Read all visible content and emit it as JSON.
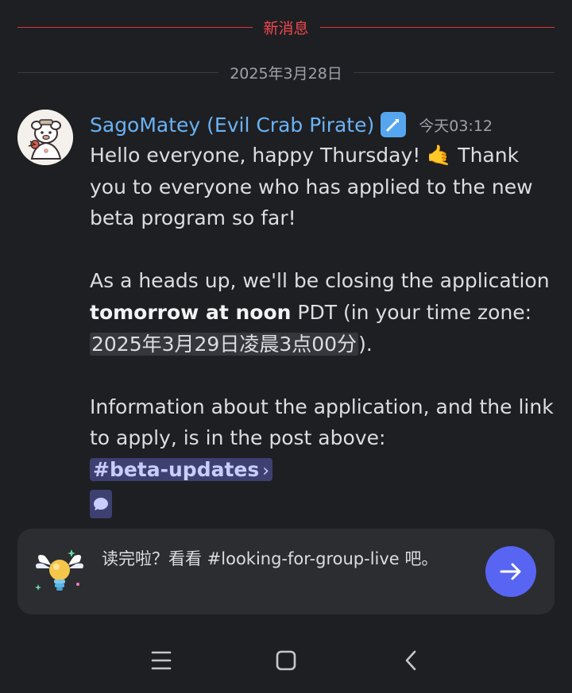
{
  "dividers": {
    "new_messages": "新消息",
    "date": "2025年3月28日"
  },
  "message": {
    "author": "SagoMatey (Evil Crab Pirate)",
    "timestamp": "今天03:12",
    "badge_icon": "wrench-badge-icon",
    "paragraph1_a": "Hello everyone, happy Thursday! ",
    "paragraph1_emoji": "🤙",
    "paragraph1_b": " Thank you to everyone who has applied to the new beta program so far!",
    "paragraph2_a": "As a heads up, we'll be closing the application ",
    "paragraph2_bold": "tomorrow at noon",
    "paragraph2_b": " PDT (in your time zone: ",
    "paragraph2_timestamp": "2025年3月29日凌晨3点00分",
    "paragraph2_c": ").",
    "paragraph3_a": "Information about the application, and the link to apply, is in the post above: ",
    "channel_mention": "#beta-updates",
    "channel_chevron": "›"
  },
  "card": {
    "text": "读完啦？看看 #looking-for-group-live 吧。",
    "button_icon": "arrow-right-icon"
  },
  "navbar": {
    "icons": [
      "recent-apps-icon",
      "home-icon",
      "back-icon"
    ]
  },
  "colors": {
    "background": "#1e1f22",
    "author": "#6ab2f5",
    "new_divider": "#f0474f",
    "mention_bg": "#3d4071",
    "accent": "#5865f2"
  }
}
